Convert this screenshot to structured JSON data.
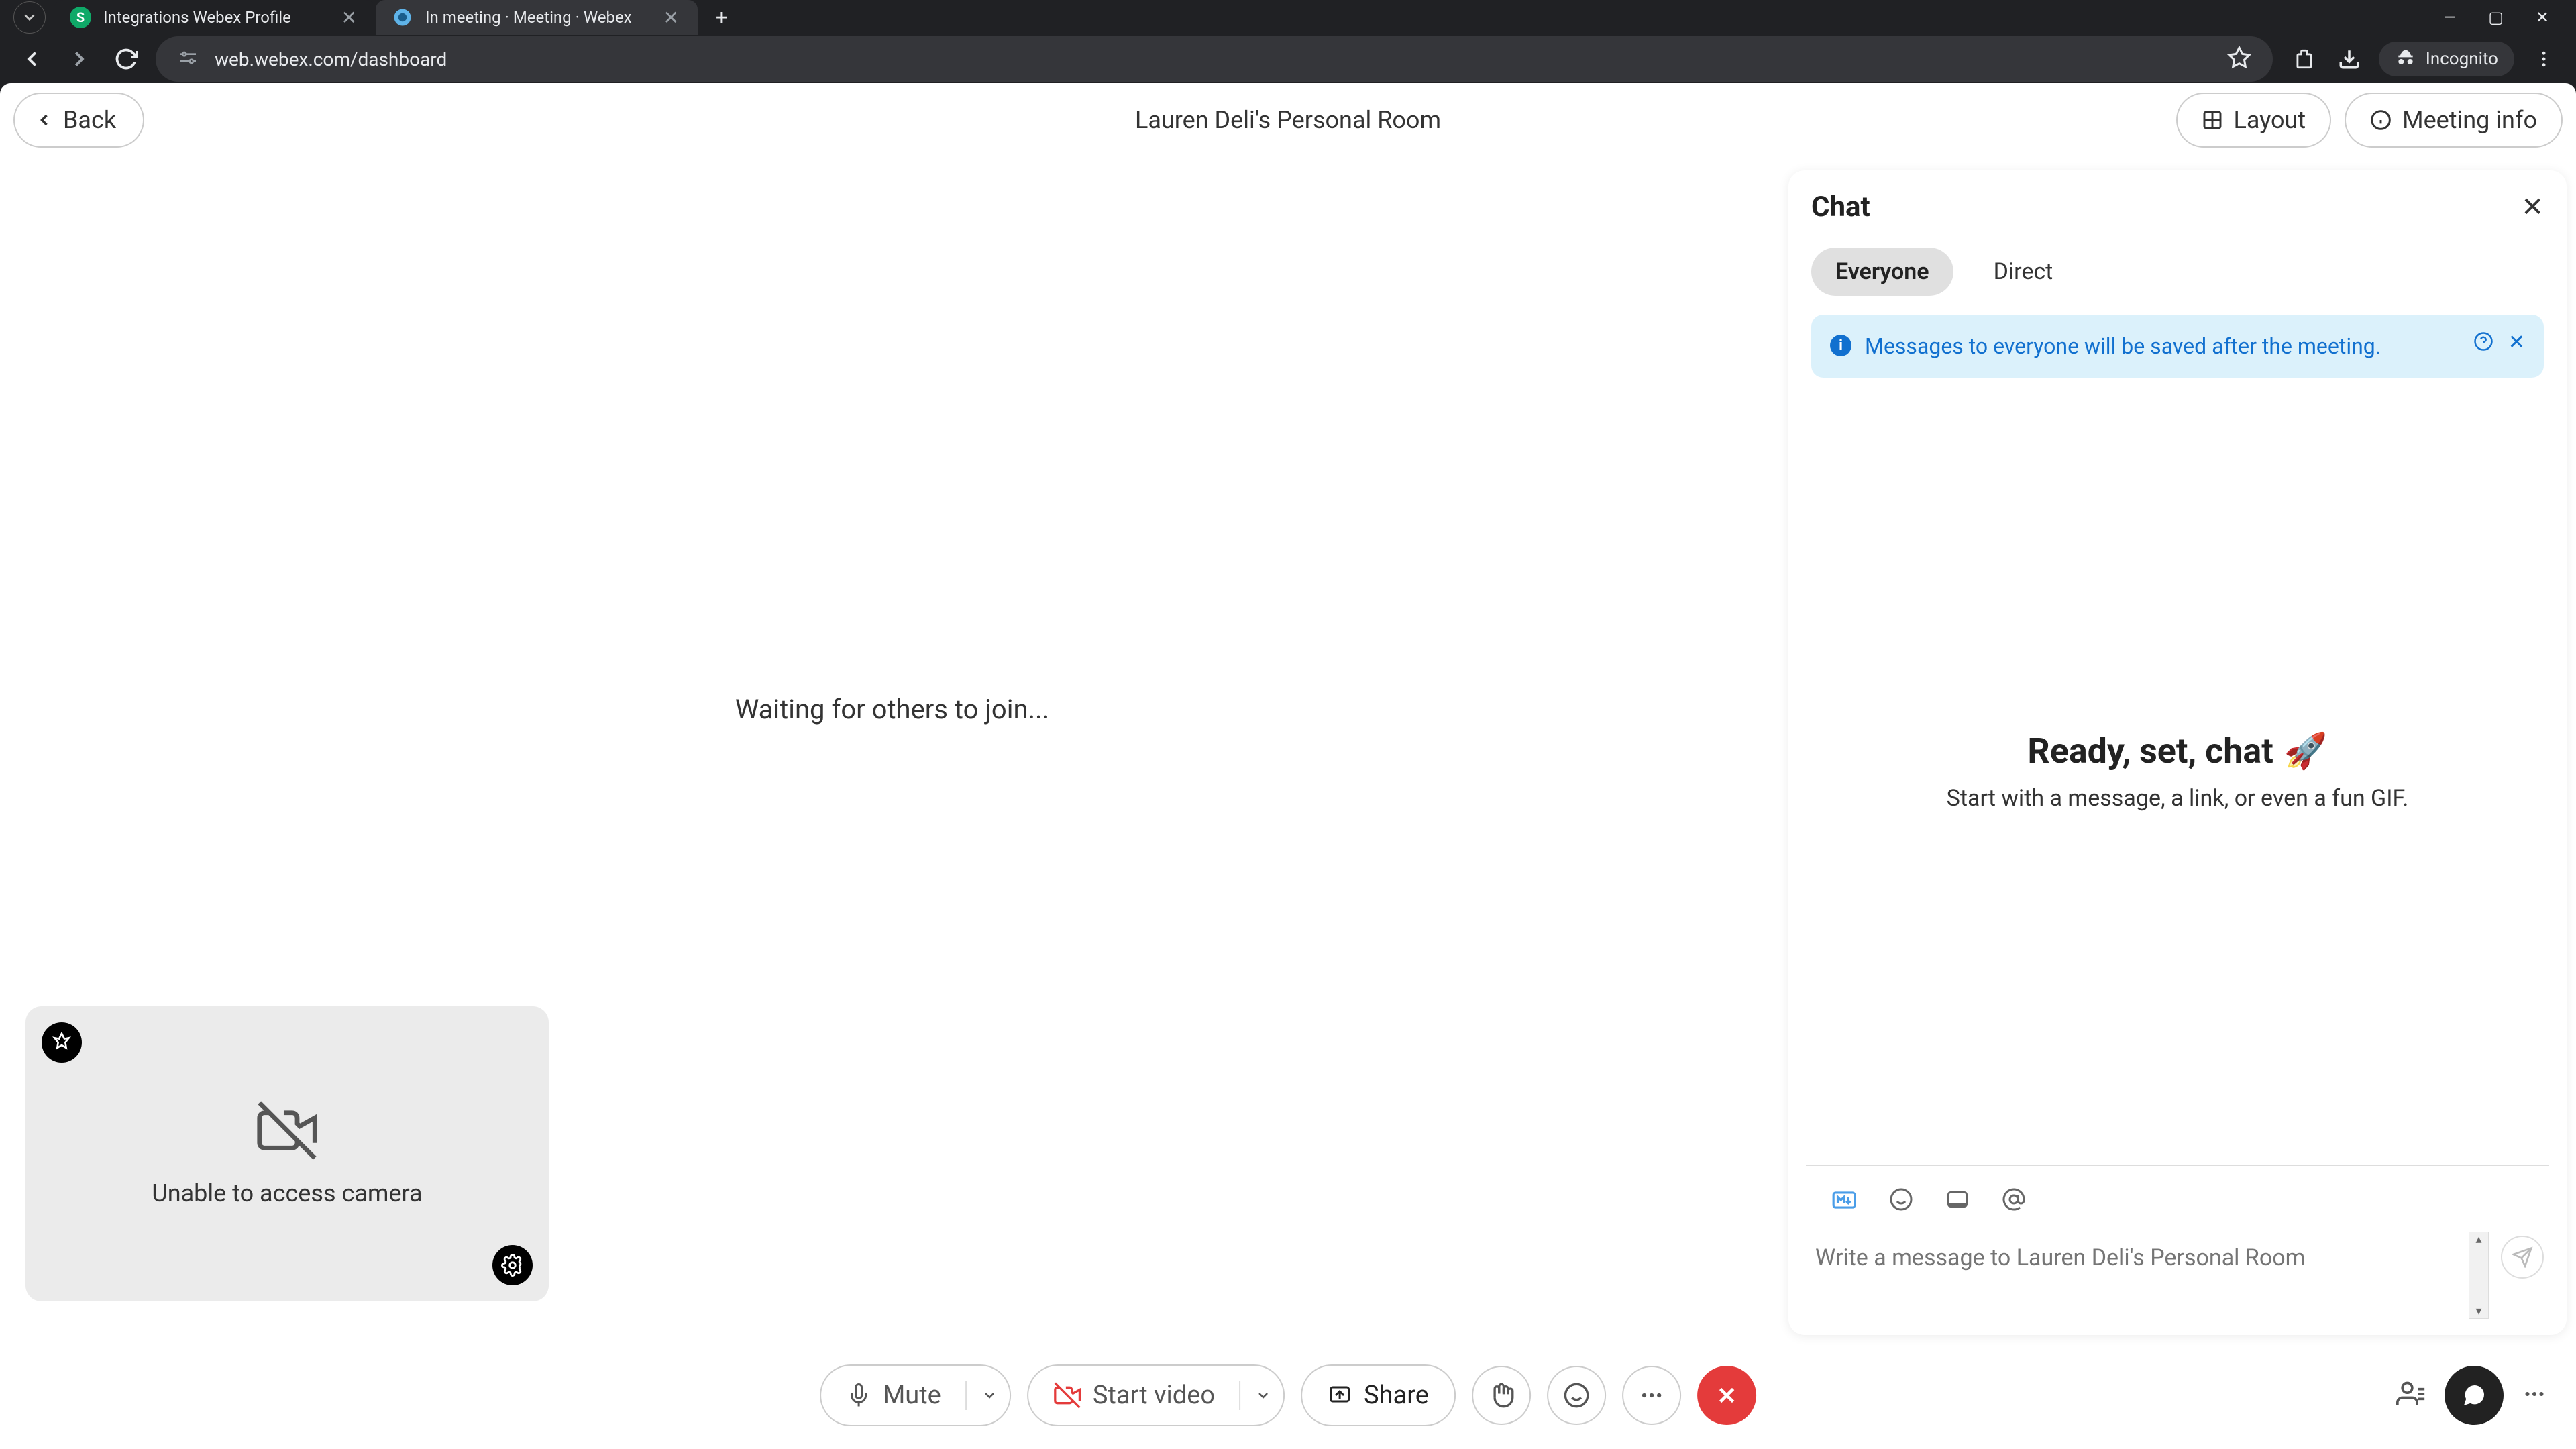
{
  "browser": {
    "tabs": [
      {
        "title": "Integrations Webex Profile",
        "favicon": "S",
        "active": false
      },
      {
        "title": "In meeting · Meeting · Webex",
        "favicon": "◐",
        "active": true
      }
    ],
    "url": "web.webex.com/dashboard",
    "incognito_label": "Incognito"
  },
  "header": {
    "back_label": "Back",
    "room_title": "Lauren Deli's Personal Room",
    "layout_label": "Layout",
    "meeting_info_label": "Meeting info"
  },
  "main": {
    "waiting_text": "Waiting for others to join..."
  },
  "self_view": {
    "camera_text": "Unable to access camera"
  },
  "chat": {
    "title": "Chat",
    "tabs": {
      "everyone": "Everyone",
      "direct": "Direct"
    },
    "banner_text": "Messages to everyone will be saved after the meeting.",
    "empty_title": "Ready, set, chat",
    "empty_sub": "Start with a message, a link, or even a fun GIF.",
    "compose_placeholder": "Write a message to Lauren Deli's Personal Room"
  },
  "toolbar": {
    "mute_label": "Mute",
    "start_video_label": "Start video",
    "share_label": "Share"
  }
}
